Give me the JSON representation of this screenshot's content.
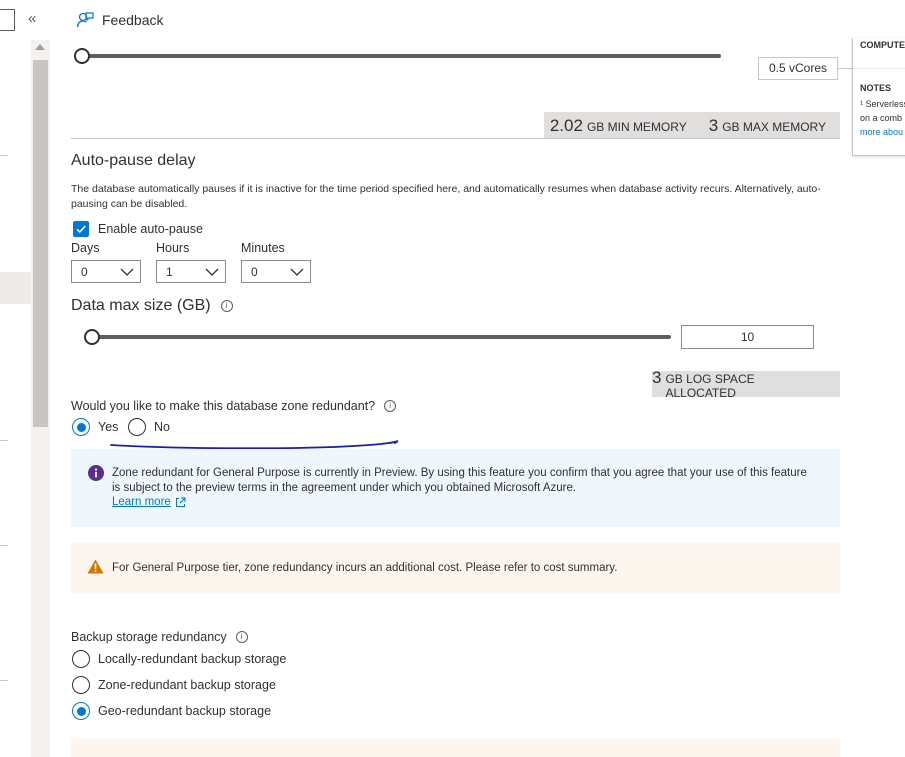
{
  "header": {
    "feedback_label": "Feedback"
  },
  "vcores": {
    "value_label": "0.5 vCores"
  },
  "memory": {
    "min_value": "2.02",
    "min_unit": "GB MIN MEMORY",
    "max_value": "3",
    "max_unit": "GB MAX MEMORY"
  },
  "summary": {
    "compute_label": "COMPUTE",
    "notes_label": "NOTES",
    "note_line1": "¹ Serverless",
    "note_line2": "on a comb",
    "note_link": "more abou"
  },
  "auto_pause": {
    "title": "Auto-pause delay",
    "description": "The database automatically pauses if it is inactive for the time period specified here, and automatically resumes when database activity recurs. Alternatively, auto-pausing can be disabled.",
    "enable_label": "Enable auto-pause",
    "enabled": true,
    "days_label": "Days",
    "days_value": "0",
    "hours_label": "Hours",
    "hours_value": "1",
    "minutes_label": "Minutes",
    "minutes_value": "0"
  },
  "data_max": {
    "title": "Data max size (GB)",
    "value": "10",
    "log_value": "3",
    "log_unit": "GB LOG SPACE ALLOCATED"
  },
  "zone": {
    "question": "Would you like to make this database zone redundant?",
    "yes_label": "Yes",
    "no_label": "No",
    "selected": "Yes"
  },
  "info_banner": {
    "text": "Zone redundant for General Purpose is currently in Preview. By using this feature you confirm that you agree that your use of this feature is subject to the preview terms in the agreement under which you obtained Microsoft Azure.",
    "link": "Learn more"
  },
  "warning_banner": {
    "text": "For General Purpose tier, zone redundancy incurs an additional cost. Please refer to cost summary."
  },
  "backup": {
    "title": "Backup storage redundancy",
    "options": [
      "Locally-redundant backup storage",
      "Zone-redundant backup storage",
      "Geo-redundant backup storage"
    ],
    "selected": "Geo-redundant backup storage"
  },
  "colors": {
    "accent": "#0078d4",
    "info_bg": "#eff6fc",
    "warning_bg": "#fdf6ef",
    "warning_icon": "#d47500",
    "annotation_ink": "#1a1ab8"
  }
}
